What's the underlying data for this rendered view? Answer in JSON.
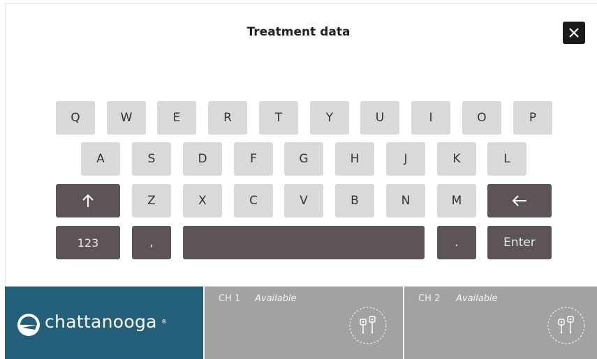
{
  "dialog": {
    "title": "Treatment data",
    "close_icon": "close-icon"
  },
  "keyboard": {
    "row1": [
      "Q",
      "W",
      "E",
      "R",
      "T",
      "Y",
      "U",
      "I",
      "O",
      "P"
    ],
    "row2": [
      "A",
      "S",
      "D",
      "F",
      "G",
      "H",
      "J",
      "K",
      "L"
    ],
    "row3_letters": [
      "Z",
      "X",
      "C",
      "V",
      "B",
      "N",
      "M"
    ],
    "shift_icon": "arrow-up-icon",
    "backspace_icon": "arrow-left-icon",
    "numbers_label": "123",
    "comma_label": ",",
    "period_label": ".",
    "enter_label": "Enter",
    "colors": {
      "light_key": "#d9d9d9",
      "dark_key": "#5d5555"
    }
  },
  "footer": {
    "brand_name": "chattanooga",
    "brand_reg": "®",
    "brand_color": "#245f79",
    "channels": [
      {
        "label": "CH 1",
        "status": "Available",
        "icon": "electrode-icon"
      },
      {
        "label": "CH 2",
        "status": "Available",
        "icon": "electrode-icon"
      }
    ],
    "channel_color": "#a2a2a2"
  }
}
